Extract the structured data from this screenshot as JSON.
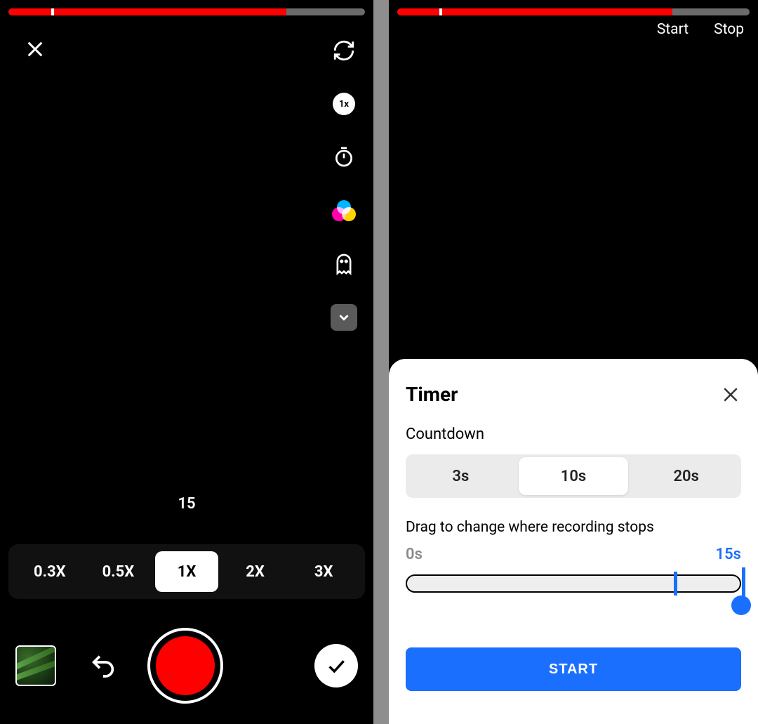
{
  "left": {
    "progress_percent": 78,
    "clip_marker_percent": 12,
    "speed_badge": "1x",
    "countdown_remaining": "15",
    "speeds": [
      "0.3X",
      "0.5X",
      "1X",
      "2X",
      "3X"
    ],
    "speed_selected_index": 2
  },
  "right": {
    "progress_percent": 78,
    "clip_marker_percent": 12,
    "label_start": "Start",
    "label_stop": "Stop",
    "sheet": {
      "title": "Timer",
      "countdown_label": "Countdown",
      "countdown_options": [
        "3s",
        "10s",
        "20s"
      ],
      "countdown_selected_index": 1,
      "drag_label": "Drag to change where recording stops",
      "range_min": "0s",
      "range_max": "15s",
      "slider_recorded_percent": 80,
      "slider_stop_percent": 100,
      "start_button": "START"
    }
  }
}
